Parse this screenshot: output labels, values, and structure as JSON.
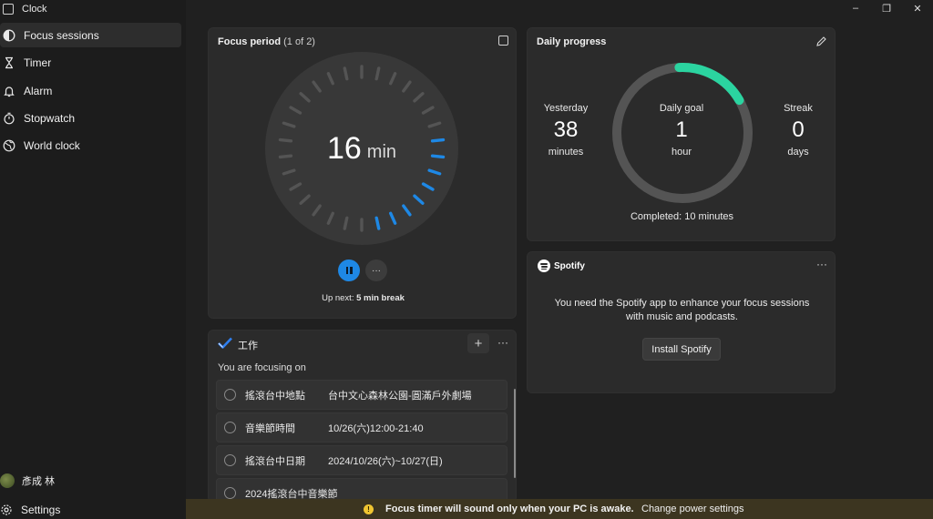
{
  "app": {
    "title": "Clock"
  },
  "window_controls": {
    "minimize": "–",
    "restore": "❐",
    "close": "✕"
  },
  "sidebar": {
    "items": [
      {
        "label": "Focus sessions",
        "icon": "focus-icon",
        "active": true
      },
      {
        "label": "Timer",
        "icon": "hourglass-icon",
        "active": false
      },
      {
        "label": "Alarm",
        "icon": "alarm-icon",
        "active": false
      },
      {
        "label": "Stopwatch",
        "icon": "stopwatch-icon",
        "active": false
      },
      {
        "label": "World clock",
        "icon": "globe-icon",
        "active": false
      }
    ],
    "user_name": "彥成 林",
    "settings_label": "Settings"
  },
  "focus": {
    "title": "Focus period",
    "period": "(1 of 2)",
    "minutes": "16",
    "unit": "min",
    "remaining_fraction": 0.27,
    "accent": "#1e88e5",
    "up_next_prefix": "Up next:",
    "up_next_value": "5 min break"
  },
  "progress": {
    "title": "Daily progress",
    "yesterday_label": "Yesterday",
    "yesterday_value": "38",
    "yesterday_unit": "minutes",
    "goal_label": "Daily goal",
    "goal_value": "1",
    "goal_unit": "hour",
    "streak_label": "Streak",
    "streak_value": "0",
    "streak_unit": "days",
    "completed_text": "Completed: 10 minutes",
    "completed_fraction": 0.167,
    "ring_color": "#2bd4a0"
  },
  "spotify": {
    "brand": "Spotify",
    "message": "You need the Spotify app to enhance your focus sessions with music and podcasts.",
    "button": "Install Spotify",
    "more": "···"
  },
  "tasks": {
    "list_name": "工作",
    "add": "+",
    "more": "···",
    "subtitle": "You are focusing on",
    "items": [
      {
        "title": "搖滾台中地點",
        "detail": "台中文心森林公園-圓滿戶外劇場"
      },
      {
        "title": "音樂節時間",
        "detail": "10/26(六)12:00-21:40"
      },
      {
        "title": "搖滾台中日期",
        "detail": "2024/10/26(六)~10/27(日)"
      },
      {
        "title": "2024搖滾台中音樂節",
        "detail": ""
      }
    ]
  },
  "banner": {
    "message": "Focus timer will sound only when your PC is awake.",
    "link": "Change power settings",
    "color": "#f0c531"
  }
}
